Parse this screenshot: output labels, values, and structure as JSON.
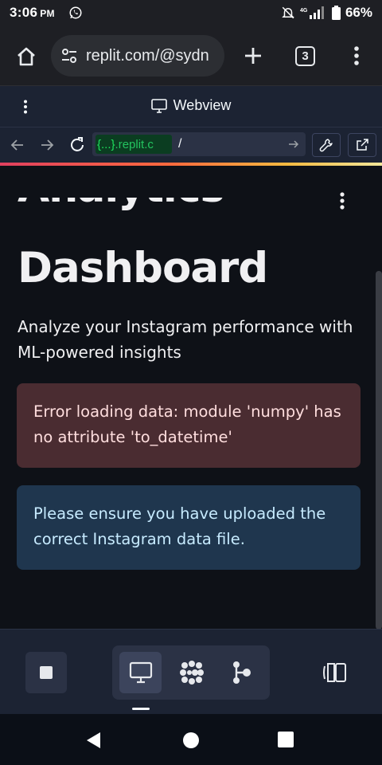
{
  "status_bar": {
    "time": "3:06",
    "ampm": "PM",
    "battery": "66%"
  },
  "browser": {
    "url": "replit.com/@sydn",
    "tab_count": "3"
  },
  "webview": {
    "title": "Webview",
    "host_prefix": "{...}",
    "host_suffix": ".replit.c",
    "path": "/"
  },
  "app": {
    "title_clipped": "Analytics",
    "title": "Dashboard",
    "subtitle": "Analyze your Instagram performance with ML-powered insights",
    "error_message": "Error loading data: module 'numpy' has no attribute 'to_datetime'",
    "info_message": "Please ensure you have uploaded the correct Instagram data file."
  },
  "colors": {
    "error_bg": "#4a2c31",
    "info_bg": "#1f364e",
    "host_green": "#1ee15d"
  },
  "icons": [
    "home-icon",
    "tune-icon",
    "plus-icon",
    "tabs-icon",
    "more-vert-icon",
    "monitor-icon",
    "back-arrow-icon",
    "forward-arrow-icon",
    "reload-icon",
    "wrench-icon",
    "open-external-icon",
    "stop-icon",
    "packages-icon",
    "workflow-icon",
    "side-panel-icon",
    "nav-back-icon",
    "nav-home-icon",
    "nav-recents-icon"
  ]
}
